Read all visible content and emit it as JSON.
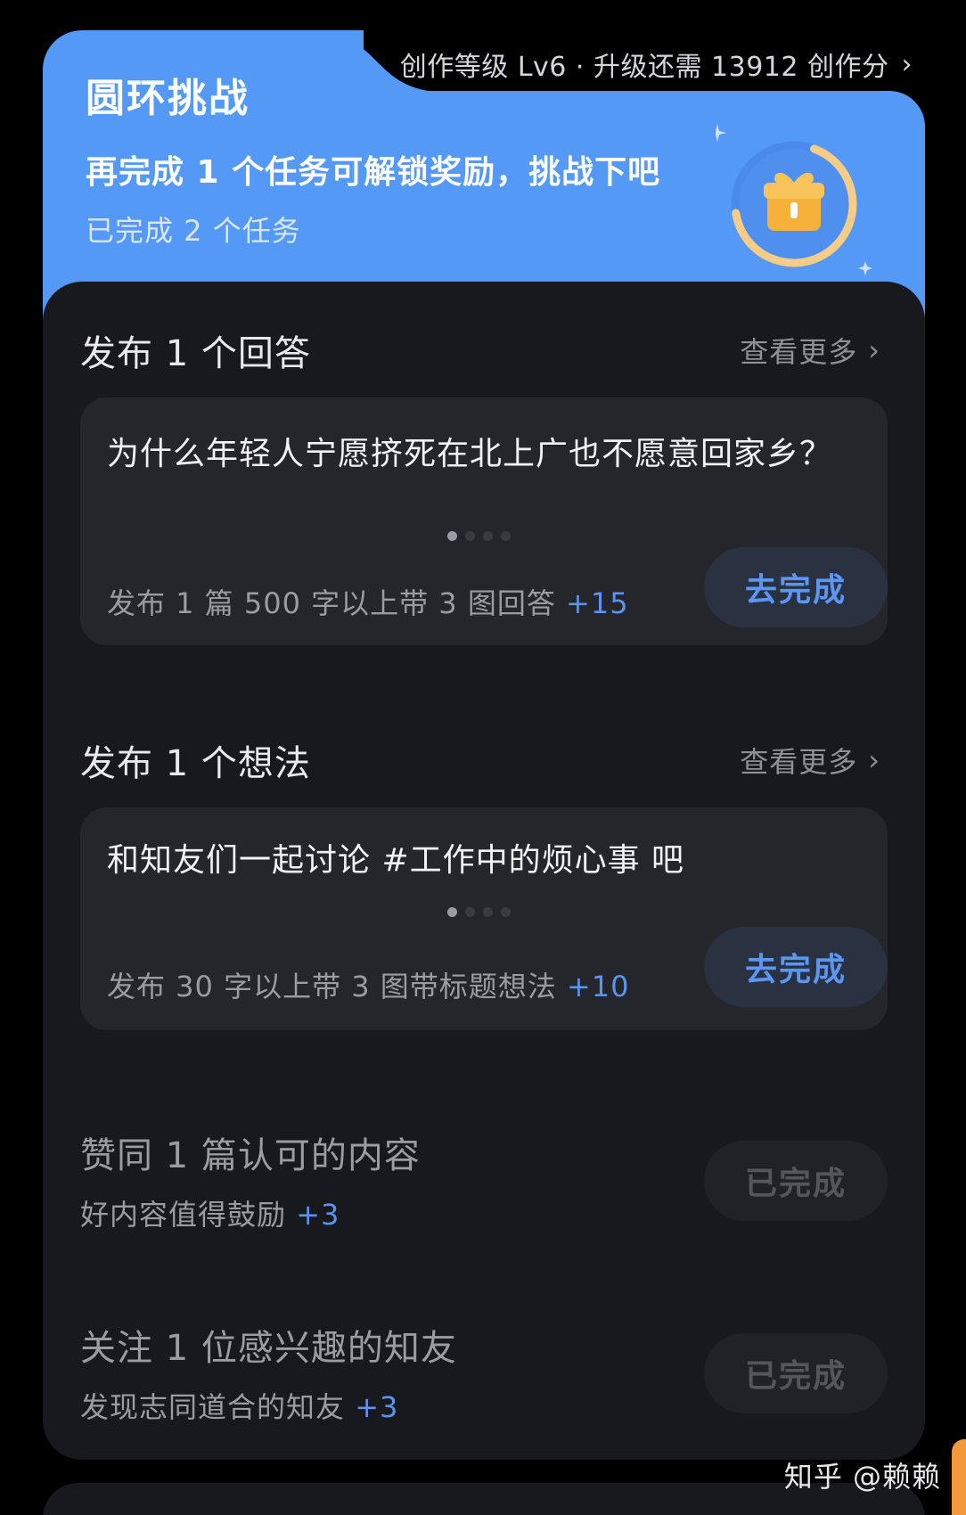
{
  "header": {
    "level_text": "创作等级 Lv6 · 升级还需 13912 创作分",
    "level_chevron": "›",
    "title": "圆环挑战",
    "subtitle": "再完成 1 个任务可解锁奖励，挑战下吧",
    "completed_text": "已完成 2 个任务",
    "progress_fraction": 0.67
  },
  "sections": [
    {
      "title": "发布 1 个回答",
      "see_more": "查看更多",
      "chevron": "›",
      "card_text": "为什么年轻人宁愿挤死在北上广也不愿意回家乡？",
      "task_desc": "发布 1 篇 500 字以上带 3 图回答",
      "points": "+15",
      "button": "去完成"
    },
    {
      "title": "发布 1 个想法",
      "see_more": "查看更多",
      "chevron": "›",
      "card_text": "和知友们一起讨论 #工作中的烦心事 吧",
      "task_desc": "发布 30 字以上带 3 图带标题想法",
      "points": "+10",
      "button": "去完成"
    }
  ],
  "simple_tasks": [
    {
      "title": "赞同 1 篇认可的内容",
      "desc": "好内容值得鼓励",
      "points": "+3",
      "button": "已完成"
    },
    {
      "title": "关注 1 位感兴趣的知友",
      "desc": "发现志同道合的知友",
      "points": "+3",
      "button": "已完成"
    }
  ],
  "watermark": "知乎 @赖赖",
  "colors": {
    "header_blue": "#5599f6",
    "panel_dark": "#18191d",
    "accent_blue": "#5c96f5",
    "gift_orange": "#f6b13b"
  },
  "icons": {
    "gift": "gift-icon",
    "sparkle": "sparkle-icon"
  }
}
